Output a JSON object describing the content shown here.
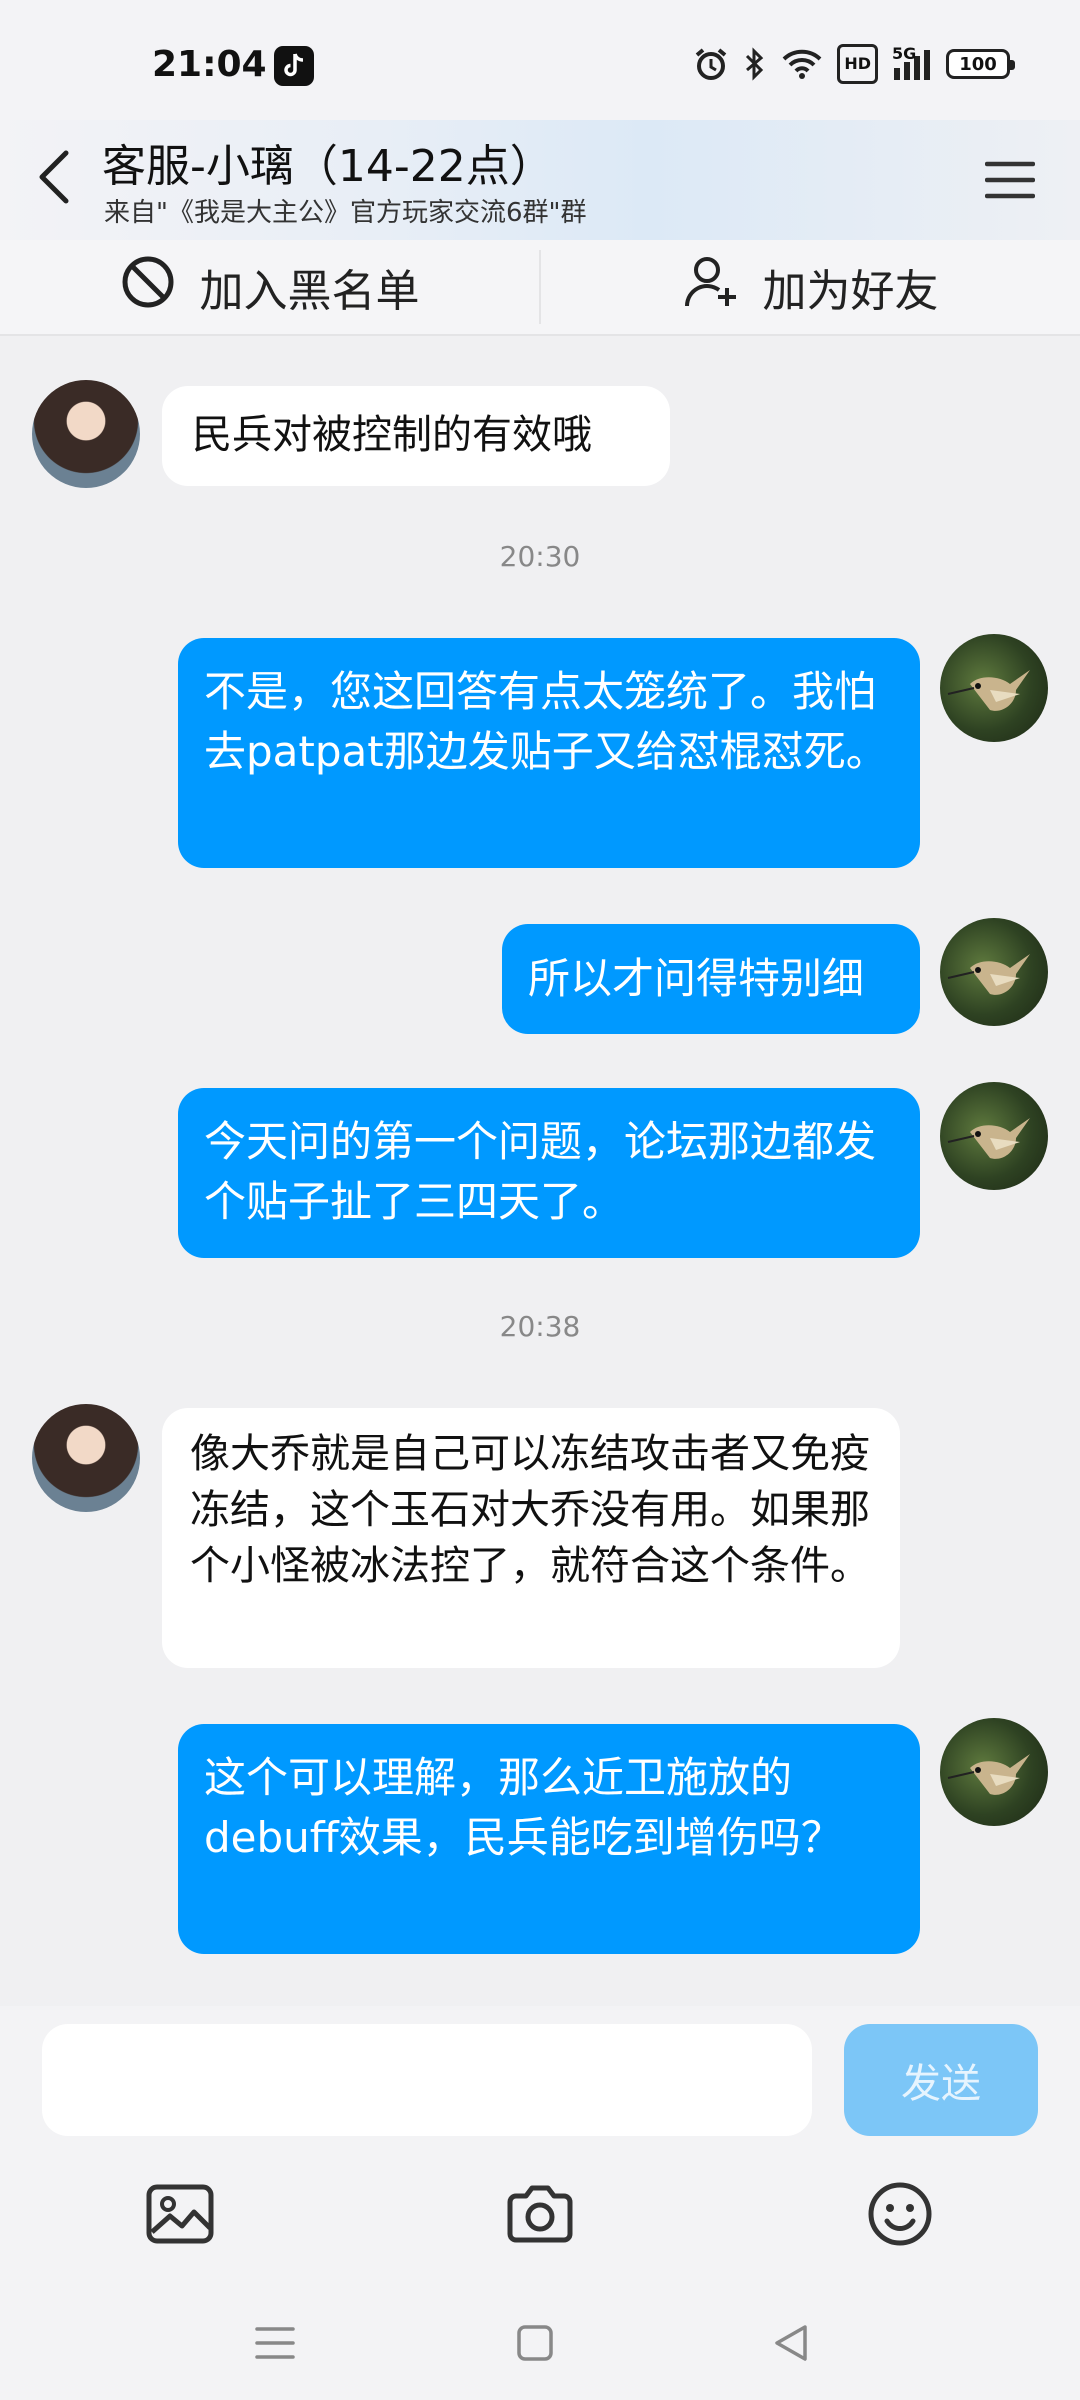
{
  "status_bar": {
    "time": "21:04",
    "app_icon": "tiktok-icon",
    "icons": [
      "alarm-icon",
      "bluetooth-icon",
      "wifi-icon",
      "hd-icon",
      "signal-5g-icon",
      "battery-icon"
    ],
    "hd_label": "HD",
    "network_label": "5G",
    "battery": "100"
  },
  "header": {
    "title": "客服-小璃（14-22点）",
    "subtitle": "来自\"《我是大主公》官方玩家交流6群\"群"
  },
  "actions": {
    "block_label": "加入黑名单",
    "add_friend_label": "加为好友"
  },
  "messages": [
    {
      "side": "in",
      "text": "民兵对被控制的有效哦"
    },
    {
      "type": "time",
      "text": "20:30"
    },
    {
      "side": "out",
      "text": "不是，您这回答有点太笼统了。我怕去patpat那边发贴子又给怼棍怼死。"
    },
    {
      "side": "out",
      "text": "所以才问得特别细"
    },
    {
      "side": "out",
      "text": "今天问的第一个问题，论坛那边都发个贴子扯了三四天了。"
    },
    {
      "type": "time",
      "text": "20:38"
    },
    {
      "side": "in",
      "text": "像大乔就是自己可以冻结攻击者又免疫冻结，这个玉石对大乔没有用。如果那个小怪被冰法控了，就符合这个条件。"
    },
    {
      "side": "out",
      "text": "这个可以理解，那么近卫施放的debuff效果，民兵能吃到增伤吗？"
    }
  ],
  "input": {
    "value": "",
    "placeholder": "",
    "send_label": "发送"
  },
  "colors": {
    "outgoing_bubble": "#0099ff",
    "send_button": "#7cc6f7"
  }
}
